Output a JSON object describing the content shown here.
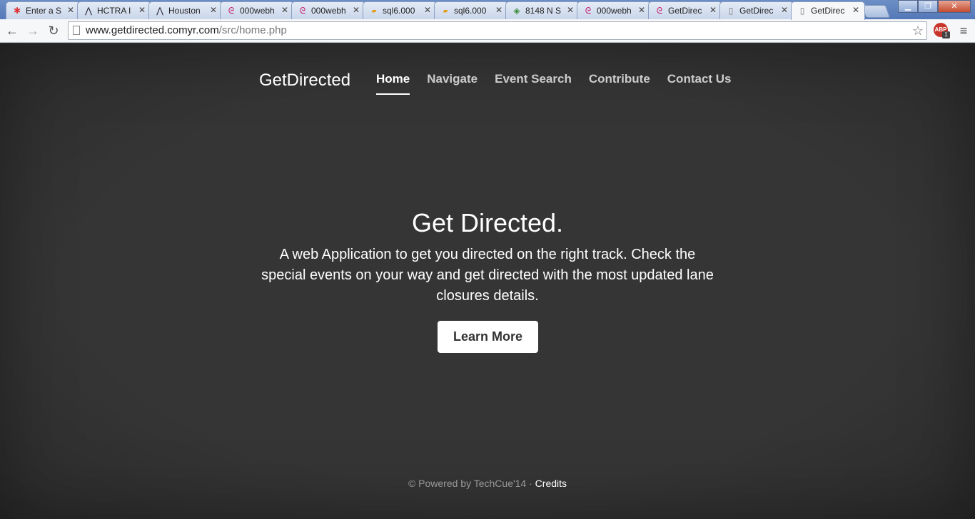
{
  "browser": {
    "tabs": [
      {
        "title": "Enter a S",
        "icon": "colorful-pinwheel-icon",
        "active": false
      },
      {
        "title": "HCTRA I",
        "icon": "hctra-logo-icon",
        "active": false
      },
      {
        "title": "Houston",
        "icon": "hctra-logo-icon",
        "active": false
      },
      {
        "title": "000webh",
        "icon": "swirl-icon",
        "active": false
      },
      {
        "title": "000webh",
        "icon": "swirl-icon",
        "active": false
      },
      {
        "title": "sql6.000",
        "icon": "phpmyadmin-icon",
        "active": false
      },
      {
        "title": "sql6.000",
        "icon": "phpmyadmin-icon",
        "active": false
      },
      {
        "title": "8148 N S",
        "icon": "maps-icon",
        "active": false
      },
      {
        "title": "000webh",
        "icon": "swirl-icon",
        "active": false
      },
      {
        "title": "GetDirec",
        "icon": "swirl-icon",
        "active": false
      },
      {
        "title": "GetDirec",
        "icon": "page-icon",
        "active": false
      },
      {
        "title": "GetDirec",
        "icon": "page-icon",
        "active": true
      }
    ],
    "url_host": "www.getdirected.comyr.com",
    "url_path": "/src/home.php",
    "abp_label": "ABP",
    "abp_count": "1"
  },
  "site": {
    "brand": "GetDirected",
    "nav": [
      {
        "label": "Home",
        "active": true
      },
      {
        "label": "Navigate",
        "active": false
      },
      {
        "label": "Event Search",
        "active": false
      },
      {
        "label": "Contribute",
        "active": false
      },
      {
        "label": "Contact Us",
        "active": false
      }
    ],
    "hero": {
      "title": "Get Directed.",
      "text": "A web Application to get you directed on the right track. Check the special events on your way and get directed with the most updated lane closures details.",
      "button": "Learn More"
    },
    "footer": {
      "text": "© Powered by TechCue'14 · ",
      "credits": "Credits"
    }
  }
}
